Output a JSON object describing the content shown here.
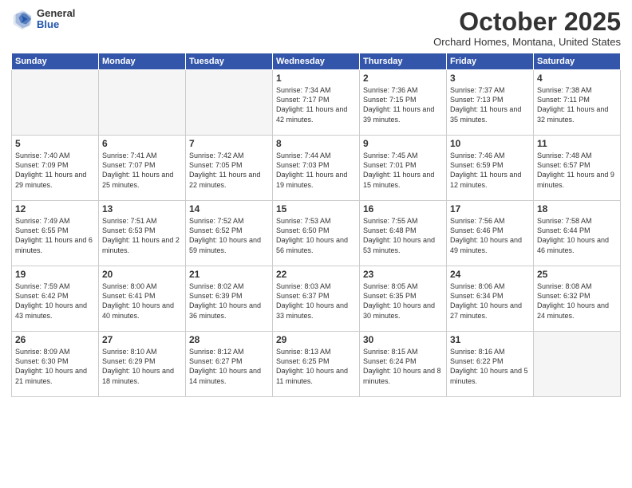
{
  "logo": {
    "general": "General",
    "blue": "Blue"
  },
  "title": "October 2025",
  "location": "Orchard Homes, Montana, United States",
  "headers": [
    "Sunday",
    "Monday",
    "Tuesday",
    "Wednesday",
    "Thursday",
    "Friday",
    "Saturday"
  ],
  "weeks": [
    [
      {
        "num": "",
        "info": ""
      },
      {
        "num": "",
        "info": ""
      },
      {
        "num": "",
        "info": ""
      },
      {
        "num": "1",
        "info": "Sunrise: 7:34 AM\nSunset: 7:17 PM\nDaylight: 11 hours\nand 42 minutes."
      },
      {
        "num": "2",
        "info": "Sunrise: 7:36 AM\nSunset: 7:15 PM\nDaylight: 11 hours\nand 39 minutes."
      },
      {
        "num": "3",
        "info": "Sunrise: 7:37 AM\nSunset: 7:13 PM\nDaylight: 11 hours\nand 35 minutes."
      },
      {
        "num": "4",
        "info": "Sunrise: 7:38 AM\nSunset: 7:11 PM\nDaylight: 11 hours\nand 32 minutes."
      }
    ],
    [
      {
        "num": "5",
        "info": "Sunrise: 7:40 AM\nSunset: 7:09 PM\nDaylight: 11 hours\nand 29 minutes."
      },
      {
        "num": "6",
        "info": "Sunrise: 7:41 AM\nSunset: 7:07 PM\nDaylight: 11 hours\nand 25 minutes."
      },
      {
        "num": "7",
        "info": "Sunrise: 7:42 AM\nSunset: 7:05 PM\nDaylight: 11 hours\nand 22 minutes."
      },
      {
        "num": "8",
        "info": "Sunrise: 7:44 AM\nSunset: 7:03 PM\nDaylight: 11 hours\nand 19 minutes."
      },
      {
        "num": "9",
        "info": "Sunrise: 7:45 AM\nSunset: 7:01 PM\nDaylight: 11 hours\nand 15 minutes."
      },
      {
        "num": "10",
        "info": "Sunrise: 7:46 AM\nSunset: 6:59 PM\nDaylight: 11 hours\nand 12 minutes."
      },
      {
        "num": "11",
        "info": "Sunrise: 7:48 AM\nSunset: 6:57 PM\nDaylight: 11 hours\nand 9 minutes."
      }
    ],
    [
      {
        "num": "12",
        "info": "Sunrise: 7:49 AM\nSunset: 6:55 PM\nDaylight: 11 hours\nand 6 minutes."
      },
      {
        "num": "13",
        "info": "Sunrise: 7:51 AM\nSunset: 6:53 PM\nDaylight: 11 hours\nand 2 minutes."
      },
      {
        "num": "14",
        "info": "Sunrise: 7:52 AM\nSunset: 6:52 PM\nDaylight: 10 hours\nand 59 minutes."
      },
      {
        "num": "15",
        "info": "Sunrise: 7:53 AM\nSunset: 6:50 PM\nDaylight: 10 hours\nand 56 minutes."
      },
      {
        "num": "16",
        "info": "Sunrise: 7:55 AM\nSunset: 6:48 PM\nDaylight: 10 hours\nand 53 minutes."
      },
      {
        "num": "17",
        "info": "Sunrise: 7:56 AM\nSunset: 6:46 PM\nDaylight: 10 hours\nand 49 minutes."
      },
      {
        "num": "18",
        "info": "Sunrise: 7:58 AM\nSunset: 6:44 PM\nDaylight: 10 hours\nand 46 minutes."
      }
    ],
    [
      {
        "num": "19",
        "info": "Sunrise: 7:59 AM\nSunset: 6:42 PM\nDaylight: 10 hours\nand 43 minutes."
      },
      {
        "num": "20",
        "info": "Sunrise: 8:00 AM\nSunset: 6:41 PM\nDaylight: 10 hours\nand 40 minutes."
      },
      {
        "num": "21",
        "info": "Sunrise: 8:02 AM\nSunset: 6:39 PM\nDaylight: 10 hours\nand 36 minutes."
      },
      {
        "num": "22",
        "info": "Sunrise: 8:03 AM\nSunset: 6:37 PM\nDaylight: 10 hours\nand 33 minutes."
      },
      {
        "num": "23",
        "info": "Sunrise: 8:05 AM\nSunset: 6:35 PM\nDaylight: 10 hours\nand 30 minutes."
      },
      {
        "num": "24",
        "info": "Sunrise: 8:06 AM\nSunset: 6:34 PM\nDaylight: 10 hours\nand 27 minutes."
      },
      {
        "num": "25",
        "info": "Sunrise: 8:08 AM\nSunset: 6:32 PM\nDaylight: 10 hours\nand 24 minutes."
      }
    ],
    [
      {
        "num": "26",
        "info": "Sunrise: 8:09 AM\nSunset: 6:30 PM\nDaylight: 10 hours\nand 21 minutes."
      },
      {
        "num": "27",
        "info": "Sunrise: 8:10 AM\nSunset: 6:29 PM\nDaylight: 10 hours\nand 18 minutes."
      },
      {
        "num": "28",
        "info": "Sunrise: 8:12 AM\nSunset: 6:27 PM\nDaylight: 10 hours\nand 14 minutes."
      },
      {
        "num": "29",
        "info": "Sunrise: 8:13 AM\nSunset: 6:25 PM\nDaylight: 10 hours\nand 11 minutes."
      },
      {
        "num": "30",
        "info": "Sunrise: 8:15 AM\nSunset: 6:24 PM\nDaylight: 10 hours\nand 8 minutes."
      },
      {
        "num": "31",
        "info": "Sunrise: 8:16 AM\nSunset: 6:22 PM\nDaylight: 10 hours\nand 5 minutes."
      },
      {
        "num": "",
        "info": ""
      }
    ]
  ]
}
